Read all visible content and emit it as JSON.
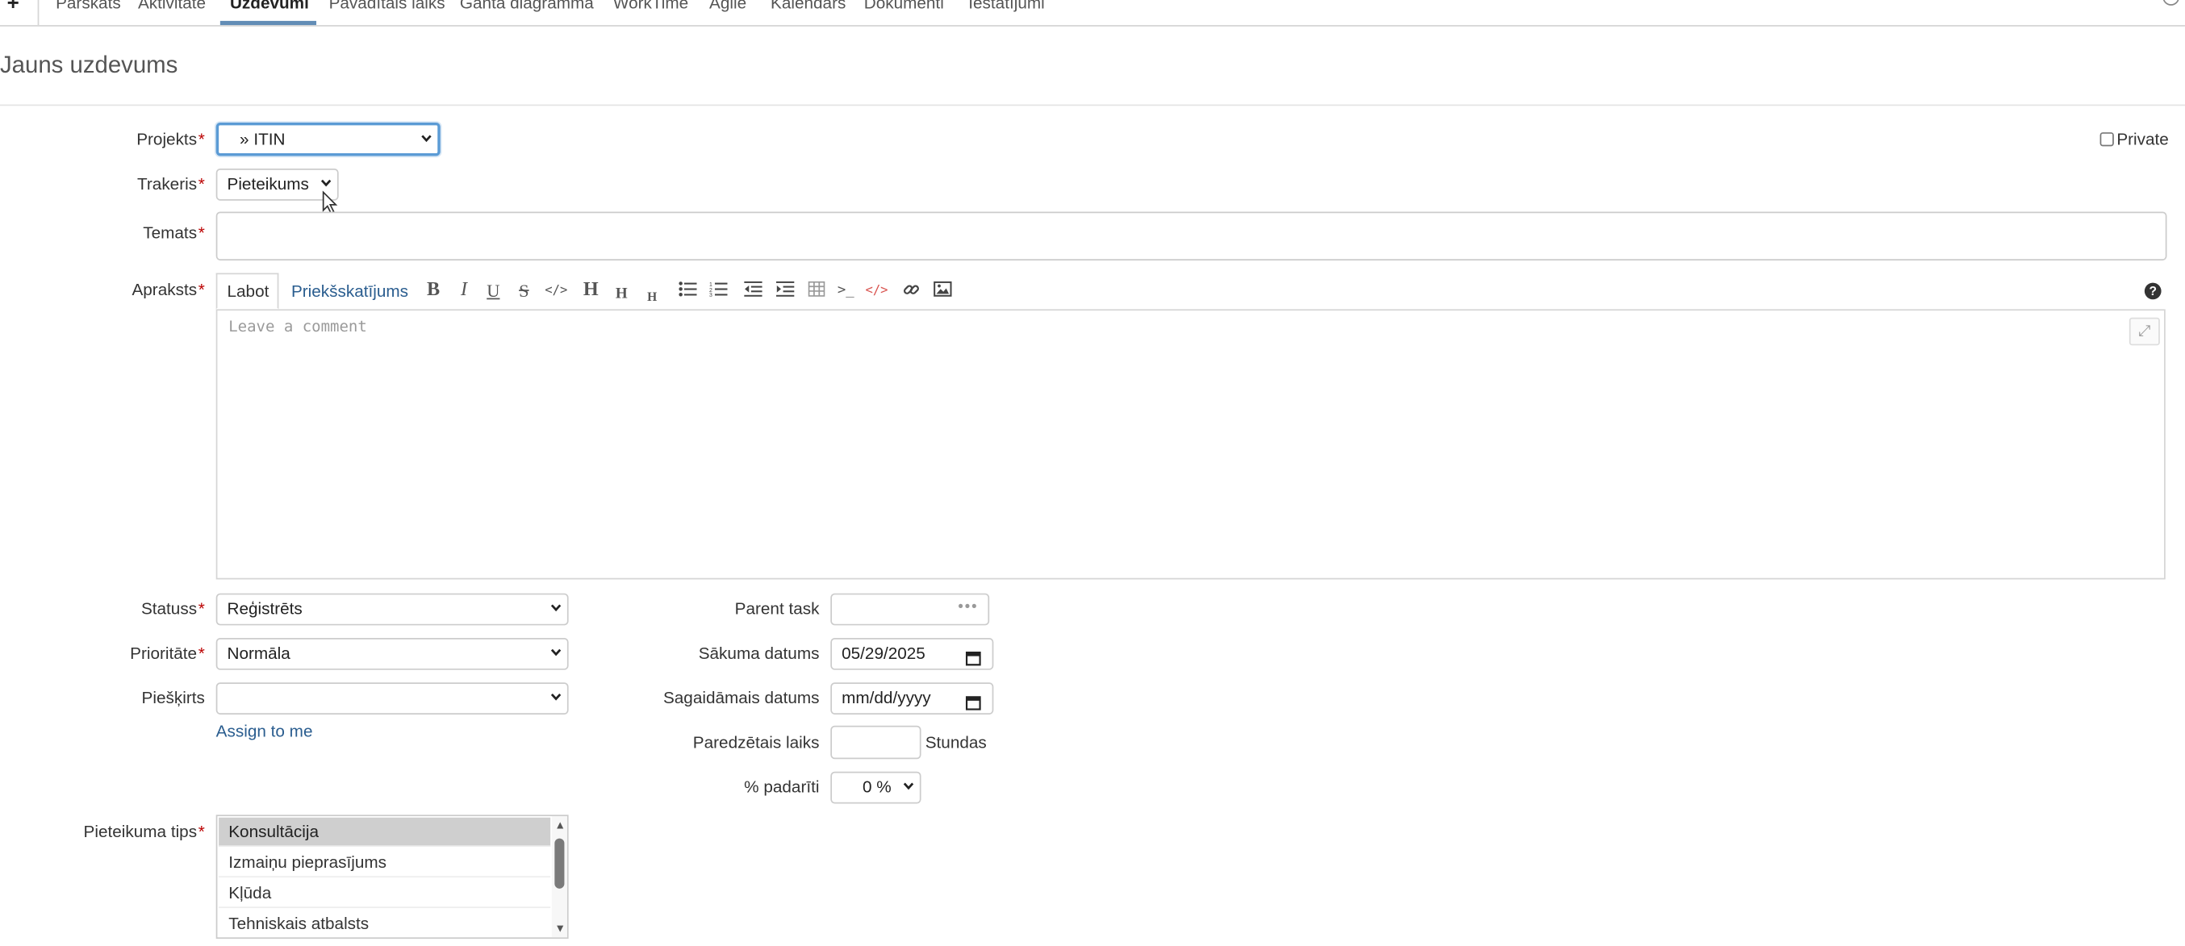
{
  "tabs": [
    {
      "label": "Pārskats"
    },
    {
      "label": "Aktivitāte"
    },
    {
      "label": "Uzdevumi"
    },
    {
      "label": "Pavadītais laiks"
    },
    {
      "label": "Ganta diagramma"
    },
    {
      "label": "WorkTime"
    },
    {
      "label": "Agile"
    },
    {
      "label": "Kalendārs"
    },
    {
      "label": "Dokumenti"
    },
    {
      "label": "Iestatījumi"
    }
  ],
  "active_tab": "Uzdevumi",
  "page_title": "Jauns uzdevums",
  "form": {
    "project": {
      "label": "Projekts",
      "value": "» ITIN"
    },
    "private": {
      "label": "Private",
      "checked": false
    },
    "tracker": {
      "label": "Trakeris",
      "value": "Pieteikums"
    },
    "subject": {
      "label": "Temats",
      "value": ""
    },
    "description": {
      "label": "Apraksts",
      "tab_edit": "Labot",
      "tab_preview": "Priekšskatījums",
      "placeholder": "Leave a comment",
      "toolbar": [
        "bold-icon",
        "italic-icon",
        "underline-icon",
        "strikethrough-icon",
        "inline-code-icon",
        "heading1-icon",
        "heading2-icon",
        "heading3-icon",
        "unordered-list-icon",
        "ordered-list-icon",
        "outdent-icon",
        "indent-icon",
        "table-icon",
        "pre-icon",
        "code-highlight-icon",
        "link-icon",
        "image-icon"
      ]
    },
    "status": {
      "label": "Statuss",
      "value": "Reģistrēts"
    },
    "priority": {
      "label": "Prioritāte",
      "value": "Normāla"
    },
    "assignee": {
      "label": "Piešķirts",
      "value": "",
      "assign_to_me": "Assign to me"
    },
    "parent_task": {
      "label": "Parent task",
      "value": ""
    },
    "start_date": {
      "label": "Sākuma datums",
      "value": "05/29/2025"
    },
    "due_date": {
      "label": "Sagaidāmais datums",
      "value": "mm/dd/yyyy"
    },
    "estimated_time": {
      "label": "Paredzētais laiks",
      "value": "",
      "unit": "Stundas"
    },
    "done_ratio": {
      "label": "% padarīti",
      "value": "0 %"
    },
    "request_type": {
      "label": "Pieteikuma tips",
      "options": [
        "Konsultācija",
        "Izmaiņu pieprasījums",
        "Kļūda",
        "Tehniskais atbalsts"
      ],
      "selected_index": 0
    }
  },
  "colors": {
    "accent": "#628DB6",
    "required": "#bb0000",
    "link": "#2a5d8f",
    "focus": "#5b9bd5"
  }
}
